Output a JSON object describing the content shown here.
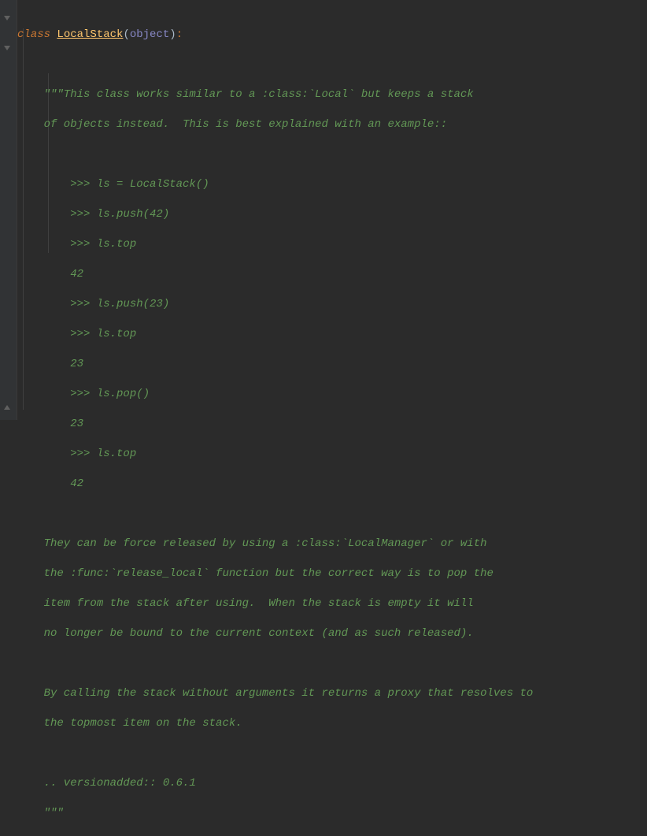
{
  "code": {
    "class_kw": "class ",
    "class_name": "LocalStack",
    "open_paren": "(",
    "base": "object",
    "close_paren": ")",
    "colon": ":",
    "doc_open": "    \"\"\"This class works similar to a :class:`Local` but keeps a stack",
    "doc_l2": "    of objects instead.  This is best explained with an example::",
    "ex_l1": "        >>> ls = LocalStack()",
    "ex_l2": "        >>> ls.push(42)",
    "ex_l3": "        >>> ls.top",
    "ex_l4": "        42",
    "ex_l5": "        >>> ls.push(23)",
    "ex_l6": "        >>> ls.top",
    "ex_l7": "        23",
    "ex_l8": "        >>> ls.pop()",
    "ex_l9": "        23",
    "ex_l10": "        >>> ls.top",
    "ex_l11": "        42",
    "p2_l1": "    They can be force released by using a :class:`LocalManager` or with",
    "p2_l2": "    the :func:`release_local` function but the correct way is to pop the",
    "p2_l3": "    item from the stack after using.  When the stack is empty it will",
    "p2_l4": "    no longer be bound to the current context (and as such released).",
    "p3_l1": "    By calling the stack without arguments it returns a proxy that resolves to",
    "p3_l2": "    the topmost item on the stack.",
    "version": "    .. versionadded:: 0.6.1",
    "doc_close": "    \"\"\""
  }
}
